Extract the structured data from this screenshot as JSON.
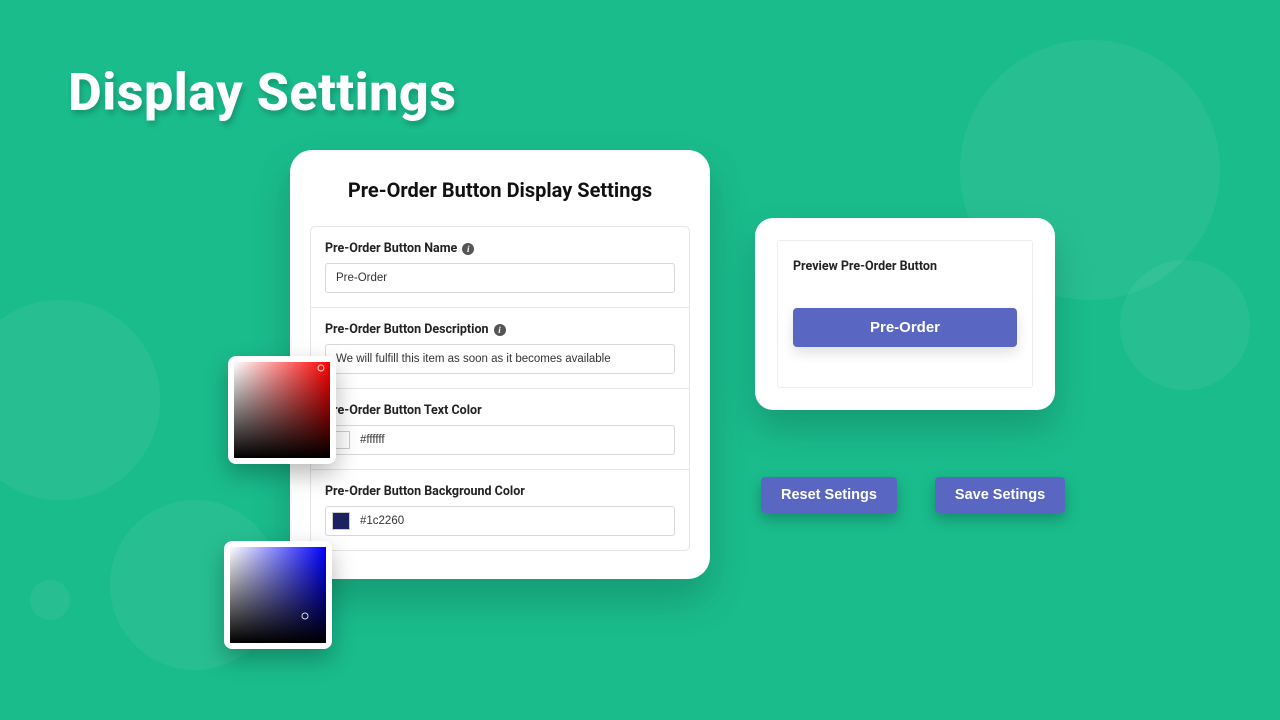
{
  "page_title": "Display Settings",
  "settings_card": {
    "title": "Pre-Order Button Display Settings",
    "fields": {
      "name": {
        "label": "Pre-Order Button Name",
        "value": "Pre-Order"
      },
      "description": {
        "label": "Pre-Order Button Description",
        "value": "We will fulfill this item as soon as it becomes available"
      },
      "text_color": {
        "label": "Pre-Order Button Text Color",
        "value": "#ffffff"
      },
      "bg_color": {
        "label": "Pre-Order Button Background Color",
        "value": "#1c2260"
      }
    }
  },
  "preview": {
    "label": "Preview Pre-Order Button",
    "button_label": "Pre-Order"
  },
  "actions": {
    "reset": "Reset Setings",
    "save": "Save Setings"
  },
  "colors": {
    "accent": "#5a67c2",
    "background": "#1abc8c",
    "text_swatch": "#ffffff",
    "bg_swatch": "#1c2260"
  }
}
